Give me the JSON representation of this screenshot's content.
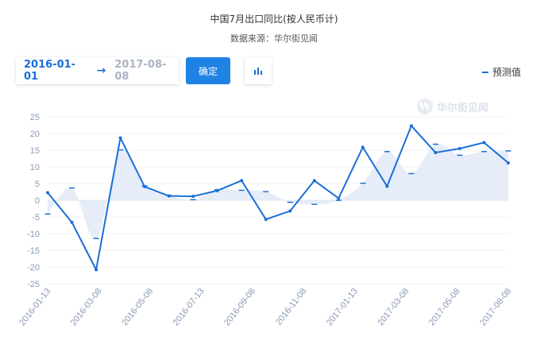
{
  "header": {
    "title": "中国7月出口同比(按人民币计)",
    "subtitle": "数据来源：华尔街见闻"
  },
  "controls": {
    "start_date": "2016-01-01",
    "arrow_icon": "→",
    "end_date": "2017-08-08",
    "confirm_label": "确定",
    "chart_icon": "bar-chart-icon"
  },
  "legend": {
    "forecast_label": "预测值"
  },
  "watermark": {
    "text": "华尔街见闻",
    "logo_letter": "W"
  },
  "colors": {
    "line": "#1a6fd8",
    "area": "#dde7f6",
    "grid": "#eef1f5",
    "axis_text": "#8a9bb5"
  },
  "chart_data": {
    "type": "line",
    "title": "中国7月出口同比(按人民币计)",
    "ylim": [
      -25,
      25
    ],
    "yticks": [
      25,
      20,
      15,
      10,
      5,
      0,
      -5,
      -10,
      -15,
      -20,
      -25
    ],
    "x_tick_labels": [
      "2016-01-13",
      "2016-03-08",
      "2016-05-08",
      "2016-07-13",
      "2016-09-08",
      "2016-11-08",
      "2017-01-13",
      "2017-03-08",
      "2017-05-08",
      "2017-08-08"
    ],
    "grid": true,
    "legend_position": "top-right",
    "series": [
      {
        "values": [
          2.3,
          -6.6,
          -20.8,
          18.7,
          4.1,
          1.3,
          1.2,
          2.9,
          5.9,
          -5.7,
          -3.2,
          5.9,
          0.6,
          15.9,
          4.2,
          22.3,
          14.3,
          15.5,
          17.3,
          11.2
        ]
      },
      {
        "name": "预测值",
        "values": [
          -4.1,
          3.7,
          -11.4,
          15.1,
          4.3,
          1.5,
          0.2,
          3.2,
          3.0,
          2.6,
          -0.6,
          -1.2,
          0.0,
          5.1,
          14.6,
          8.0,
          16.8,
          13.5,
          14.6,
          14.8
        ]
      }
    ]
  }
}
